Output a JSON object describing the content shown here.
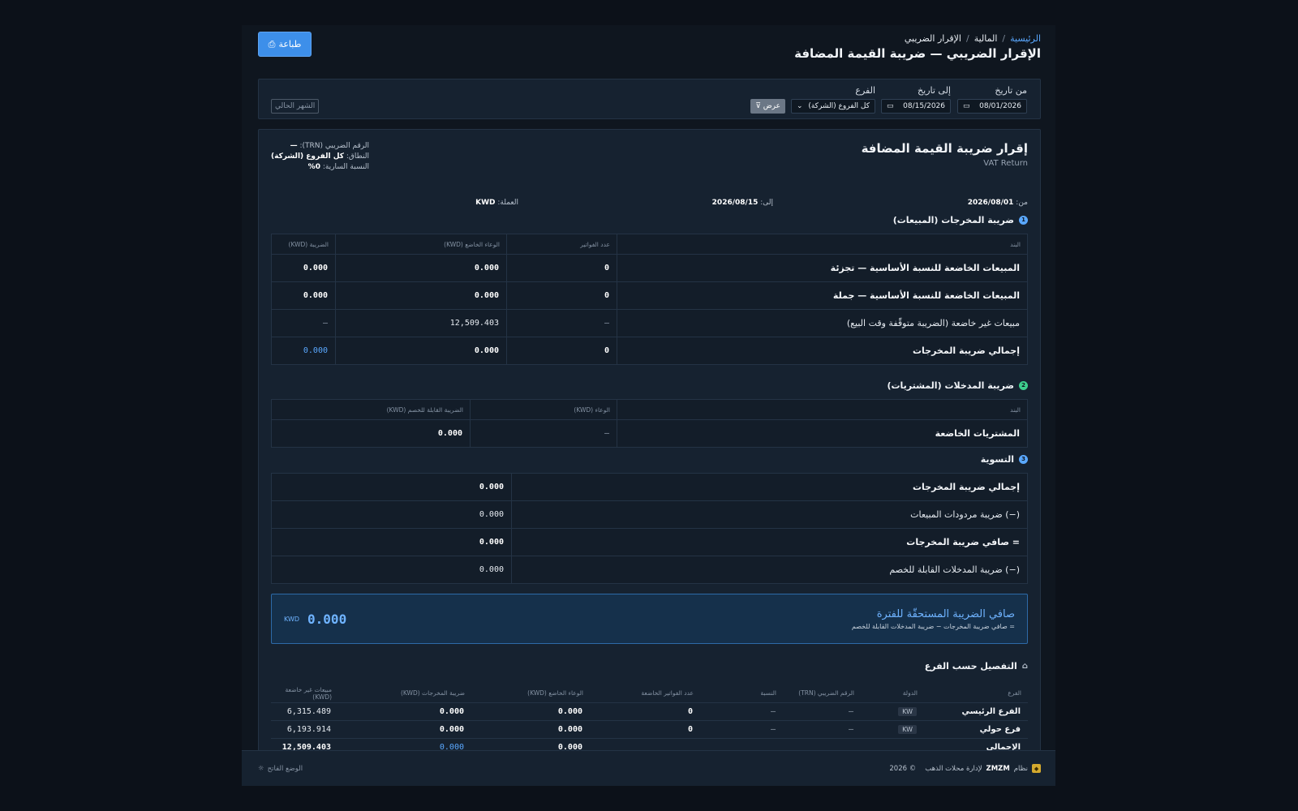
{
  "breadcrumb": {
    "home": "الرئيسية",
    "finance": "المالية",
    "current": "الإقرار الضريبي"
  },
  "page_title": "الإقرار الضريبي — ضريبة القيمة المضافة",
  "print_label": "طباعة",
  "filters": {
    "from_label": "من تاريخ",
    "to_label": "إلى تاريخ",
    "branch_label": "الفرع",
    "from_value": "08/01/2026",
    "to_value": "08/15/2026",
    "branch_value": "كل الفروع (الشركة)",
    "show_label": "عرض",
    "current_month_label": "الشهر الحالي"
  },
  "report": {
    "title": "إقرار ضريبة القيمة المضافة",
    "subtitle": "VAT Return",
    "trn_label": "الرقم الضريبي (TRN):",
    "trn_value": "—",
    "scope_label": "النطاق:",
    "scope_value": "كل الفروع (الشركة)",
    "rate_label": "النسبة السارية:",
    "rate_value": "0%",
    "from_label": "من:",
    "from_value": "2026/08/01",
    "to_label": "إلى:",
    "to_value": "2026/08/15",
    "currency_label": "العملة:",
    "currency_value": "KWD"
  },
  "output_section": {
    "num": "1",
    "title": "ضريبة المخرجات (المبيعات)",
    "headers": [
      "البند",
      "عدد الفواتير",
      "الوعاء الخاضع (KWD)",
      "الضريبة (KWD)"
    ],
    "rows": [
      {
        "label": "المبيعات الخاضعة للنسبة الأساسية — تجزئة",
        "count": "0",
        "base": "0.000",
        "tax": "0.000"
      },
      {
        "label": "المبيعات الخاضعة للنسبة الأساسية — جملة",
        "count": "0",
        "base": "0.000",
        "tax": "0.000"
      },
      {
        "label": "مبيعات غير خاضعة (الضريبة متوقّفة وقت البيع)",
        "count": "—",
        "base": "12,509.403",
        "tax": "—"
      },
      {
        "label": "إجمالي ضريبة المخرجات",
        "count": "0",
        "base": "0.000",
        "tax": "0.000"
      }
    ]
  },
  "input_section": {
    "num": "2",
    "title": "ضريبة المدخلات (المشتريات)",
    "headers": [
      "البند",
      "الوعاء (KWD)",
      "الضريبة القابلة للخصم (KWD)"
    ],
    "rows": [
      {
        "label": "المشتريات الخاضعة",
        "base": "—",
        "tax": "0.000"
      }
    ]
  },
  "settlement": {
    "num": "3",
    "title": "التسوية",
    "rows": [
      {
        "label": "إجمالي ضريبة المخرجات",
        "value": "0.000"
      },
      {
        "label": "(−) ضريبة مردودات المبيعات",
        "value": "0.000"
      },
      {
        "label": "= صافي ضريبة المخرجات",
        "value": "0.000"
      },
      {
        "label": "(−) ضريبة المدخلات القابلة للخصم",
        "value": "0.000"
      }
    ]
  },
  "net": {
    "title": "صافي الضريبة المستحقّة للفترة",
    "desc": "= صافي ضريبة المخرجات − ضريبة المدخلات القابلة للخصم",
    "amount": "0.000",
    "currency": "KWD"
  },
  "branch_section": {
    "title": "التفصيل حسب الفرع",
    "headers": [
      "الفرع",
      "الدولة",
      "الرقم الضريبي (TRN)",
      "النسبة",
      "عدد الفواتير الخاضعة",
      "الوعاء الخاضع (KWD)",
      "ضريبة المخرجات (KWD)",
      "مبيعات غير خاضعة (KWD)"
    ],
    "rows": [
      {
        "name": "الفرع الرئيسي",
        "country": "KW",
        "trn": "—",
        "rate": "—",
        "count": "0",
        "base": "0.000",
        "tax": "0.000",
        "untaxed": "6,315.489"
      },
      {
        "name": "فرع حولي",
        "country": "KW",
        "trn": "—",
        "rate": "—",
        "count": "0",
        "base": "0.000",
        "tax": "0.000",
        "untaxed": "6,193.914"
      },
      {
        "name": "الإجمالي",
        "country": "",
        "trn": "",
        "rate": "",
        "count": "",
        "base": "0.000",
        "tax": "0.000",
        "untaxed": "12,509.403"
      }
    ]
  },
  "footer": {
    "brand": "ZMZM",
    "system": "نظام",
    "desc": "لإدارة محلات الذهب",
    "year": "© 2026",
    "theme_label": "الوضع الفاتح"
  },
  "colors": {
    "accent": "#3d8fea",
    "badge1": "#5aa8ff",
    "badge2": "#3ecf8e",
    "badge3": "#5aa8ff",
    "logo": "#d3a92e"
  }
}
